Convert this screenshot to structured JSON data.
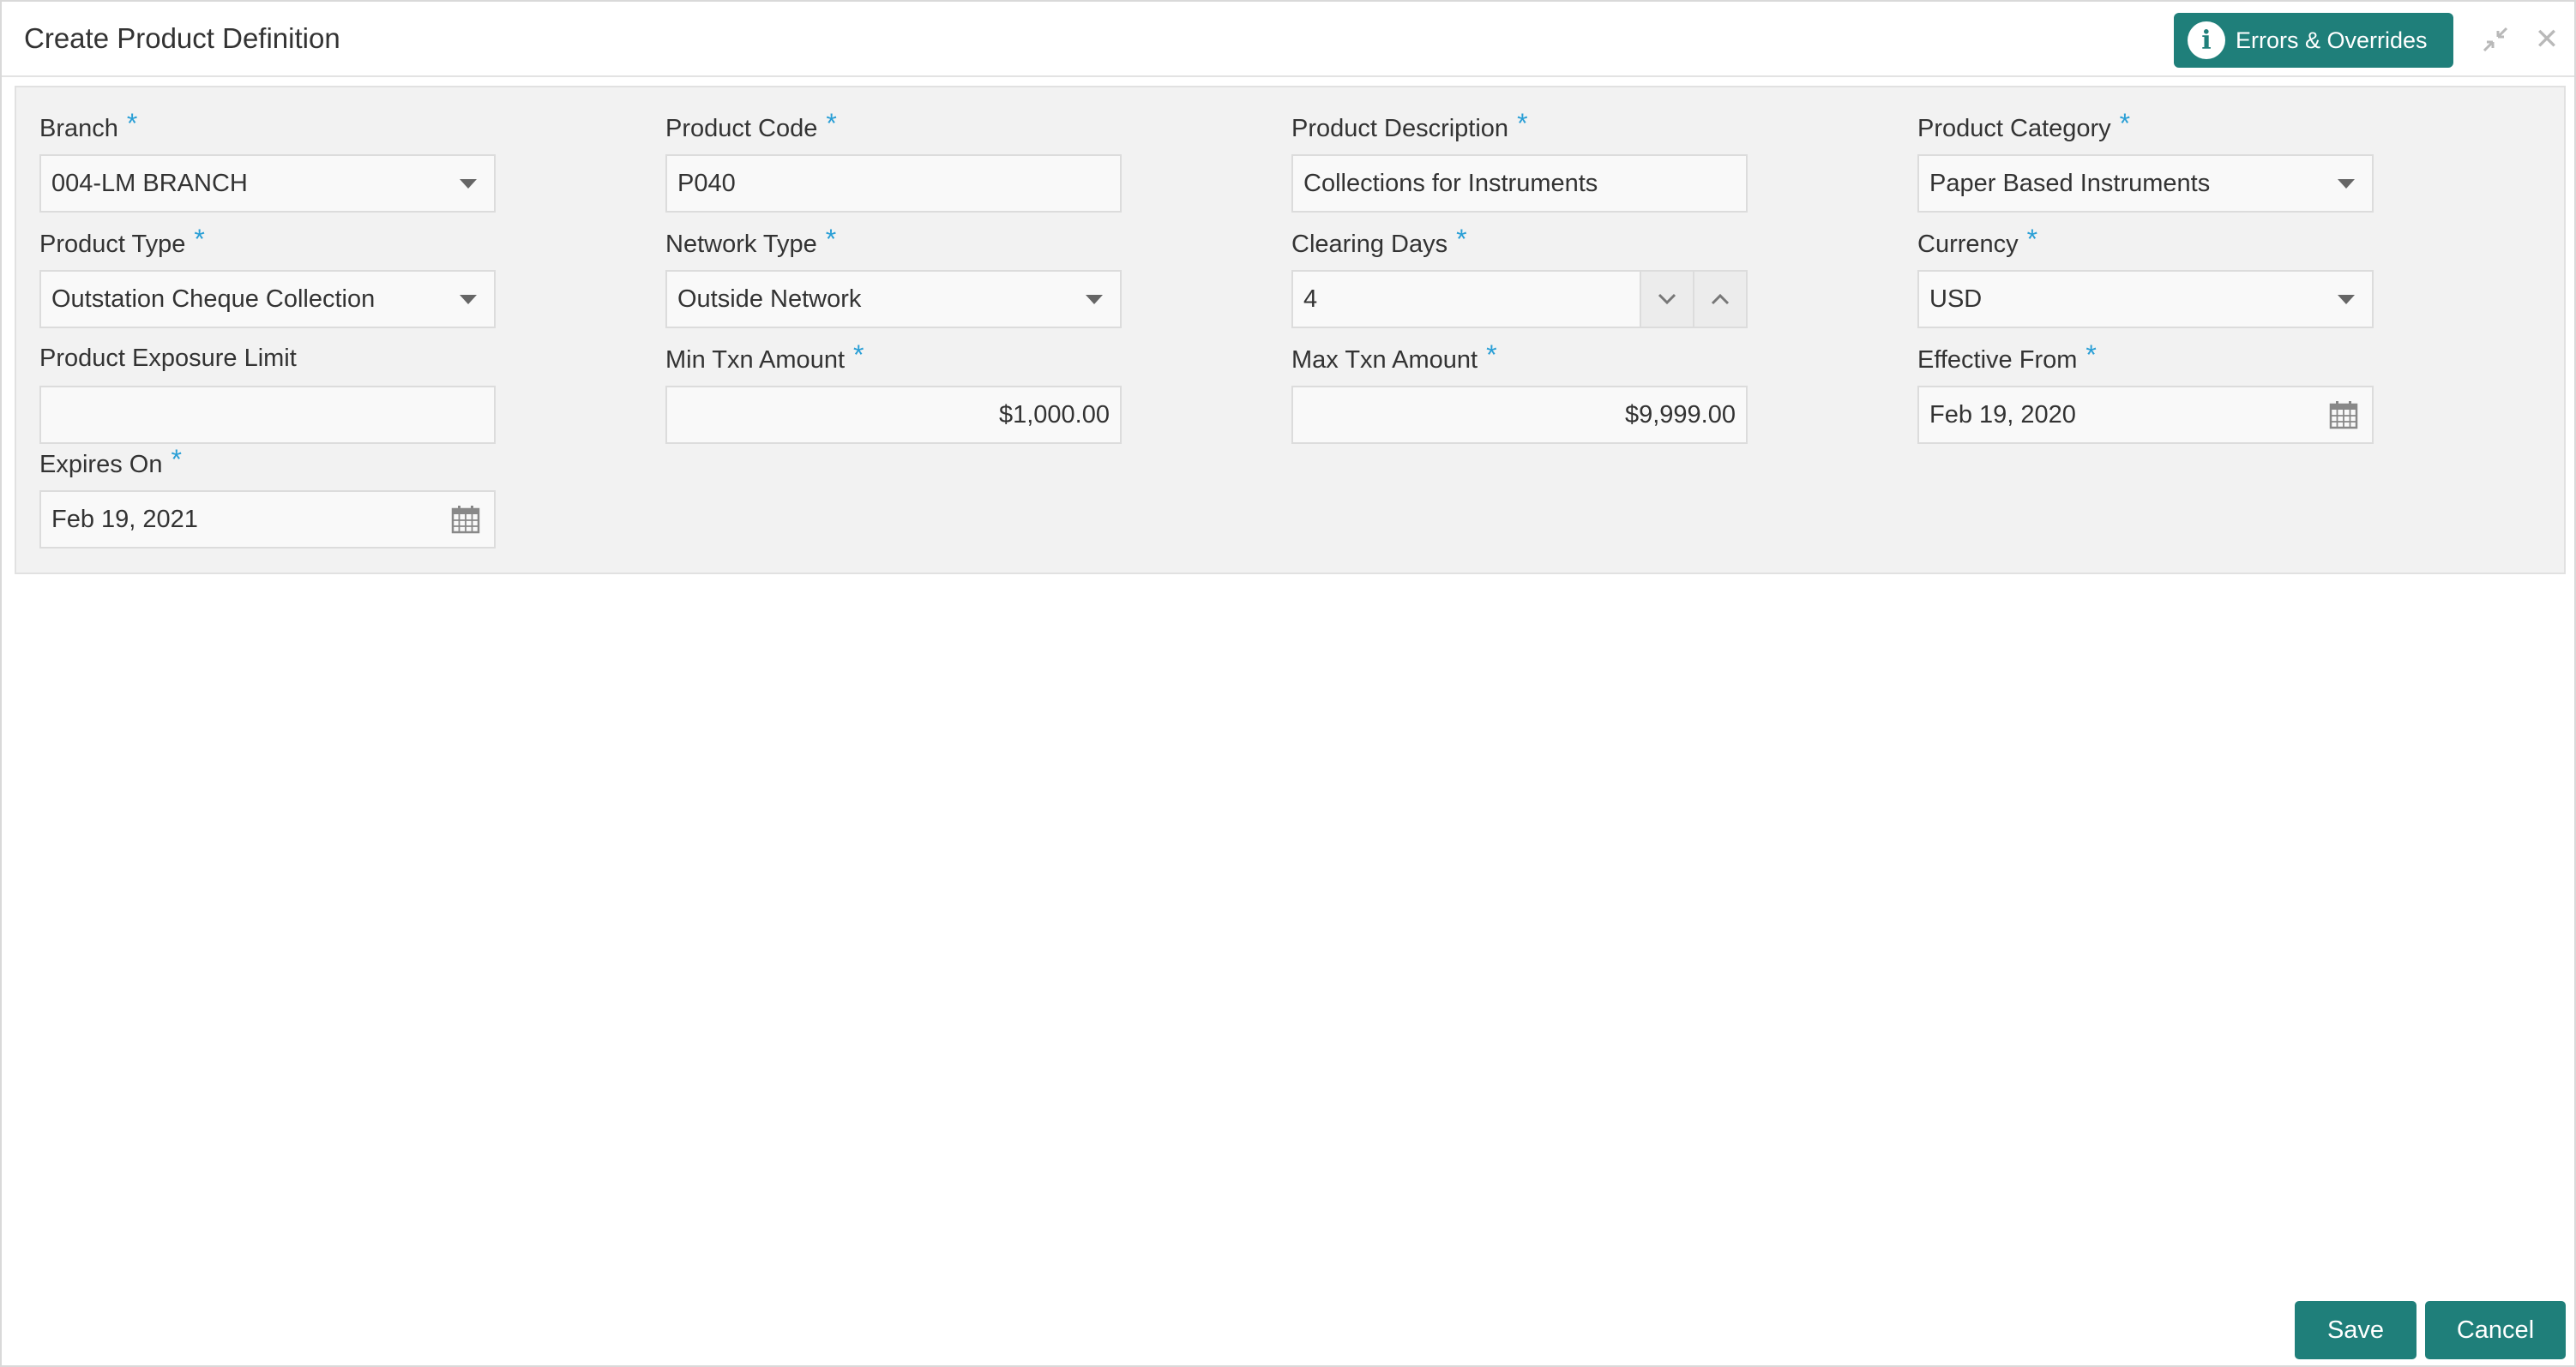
{
  "window": {
    "title": "Create Product Definition",
    "errors_button_label": "Errors & Overrides"
  },
  "colors": {
    "accent": "#1f7f7a",
    "required_marker": "#2a9fd6"
  },
  "required_marker": "*",
  "fields": {
    "branch": {
      "label": "Branch",
      "value": "004-LM BRANCH",
      "required": true,
      "type": "select"
    },
    "product_code": {
      "label": "Product Code",
      "value": "P040",
      "required": true,
      "type": "text"
    },
    "product_description": {
      "label": "Product Description",
      "value": "Collections for Instruments",
      "required": true,
      "type": "text"
    },
    "product_category": {
      "label": "Product Category",
      "value": "Paper Based Instruments",
      "required": true,
      "type": "select"
    },
    "product_type": {
      "label": "Product Type",
      "value": "Outstation Cheque Collection",
      "required": true,
      "type": "select"
    },
    "network_type": {
      "label": "Network Type",
      "value": "Outside Network",
      "required": true,
      "type": "select"
    },
    "clearing_days": {
      "label": "Clearing Days",
      "value": "4",
      "required": true,
      "type": "stepper"
    },
    "currency": {
      "label": "Currency",
      "value": "USD",
      "required": true,
      "type": "select"
    },
    "product_exposure_limit": {
      "label": "Product Exposure Limit",
      "value": "",
      "required": false,
      "type": "text"
    },
    "min_txn_amount": {
      "label": "Min Txn Amount",
      "value": "$1,000.00",
      "required": true,
      "type": "amount"
    },
    "max_txn_amount": {
      "label": "Max Txn Amount",
      "value": "$9,999.00",
      "required": true,
      "type": "amount"
    },
    "effective_from": {
      "label": "Effective From",
      "value": "Feb 19, 2020",
      "required": true,
      "type": "date"
    },
    "expires_on": {
      "label": "Expires On",
      "value": "Feb 19, 2021",
      "required": true,
      "type": "date"
    }
  },
  "footer": {
    "save_label": "Save",
    "cancel_label": "Cancel"
  },
  "icons": {
    "info": "info-icon",
    "minimize": "minimize-icon",
    "close": "close-icon",
    "dropdown": "chevron-down-icon",
    "calendar": "calendar-icon",
    "step_down": "chevron-down-icon",
    "step_up": "chevron-up-icon"
  }
}
